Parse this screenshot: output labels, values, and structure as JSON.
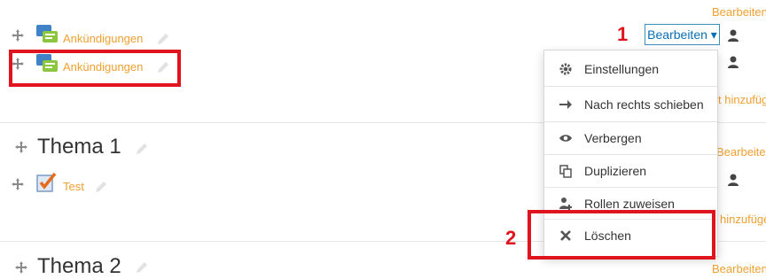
{
  "header": {
    "edit_label_top": "Bearbeiten"
  },
  "activities": [
    {
      "name": "Ankündigungen"
    },
    {
      "name": "Ankündigungen"
    },
    {
      "name": "Test"
    }
  ],
  "sections": [
    {
      "title": "Thema 1",
      "edit_label": "Bearbeiten",
      "add_label": "hinzufügen"
    },
    {
      "title": "Thema 2",
      "edit_label": "Bearbeiten"
    }
  ],
  "side_links": {
    "add_top": "t hinzufügen"
  },
  "edit_menu": {
    "button_label": "Bearbeiten ▾",
    "items": [
      {
        "label": "Einstellungen",
        "icon": "gear-icon"
      },
      {
        "label": "Nach rechts schieben",
        "icon": "arrow-right-icon"
      },
      {
        "label": "Verbergen",
        "icon": "eye-icon"
      },
      {
        "label": "Duplizieren",
        "icon": "duplicate-icon"
      },
      {
        "label": "Rollen zuweisen",
        "icon": "user-add-icon"
      },
      {
        "label": "Löschen",
        "icon": "delete-icon"
      }
    ]
  },
  "annotations": {
    "step1": "1",
    "step2": "2"
  },
  "colors": {
    "link": "#f0a030",
    "accent_blue": "#0a6fb5",
    "highlight": "#e0141e"
  }
}
